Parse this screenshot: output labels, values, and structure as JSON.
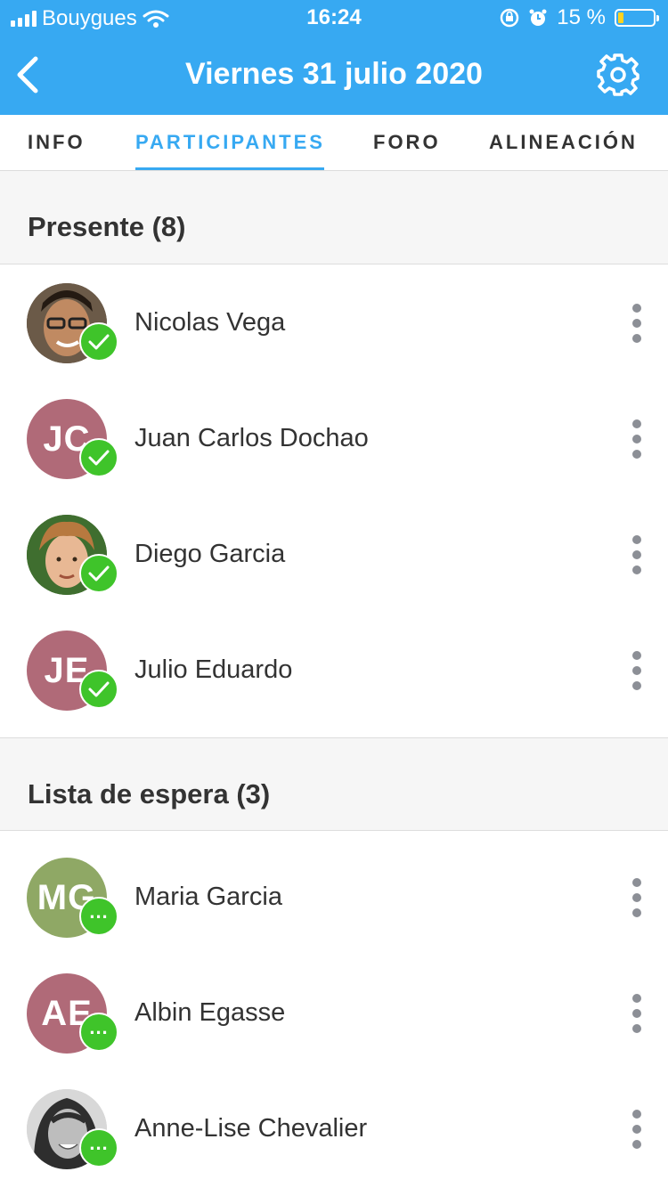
{
  "status_bar": {
    "carrier": "Bouygues",
    "time": "16:24",
    "battery": "15 %"
  },
  "header": {
    "title": "Viernes 31 julio 2020"
  },
  "tabs": [
    {
      "label": "INFO"
    },
    {
      "label": "PARTICIPANTES"
    },
    {
      "label": "FORO"
    },
    {
      "label": "ALINEACIÓN"
    }
  ],
  "present": {
    "title": "Presente (8)",
    "items": [
      {
        "name": "Nicolas Vega",
        "initials": "",
        "status": "confirmed"
      },
      {
        "name": "Juan Carlos Dochao",
        "initials": "JC",
        "status": "confirmed"
      },
      {
        "name": "Diego Garcia",
        "initials": "",
        "status": "confirmed"
      },
      {
        "name": "Julio Eduardo",
        "initials": "JE",
        "status": "confirmed"
      }
    ]
  },
  "waiting": {
    "title": "Lista de espera (3)",
    "items": [
      {
        "name": "Maria Garcia",
        "initials": "MG",
        "status": "pending"
      },
      {
        "name": "Albin Egasse",
        "initials": "AE",
        "status": "pending"
      },
      {
        "name": "Anne-Lise Chevalier",
        "initials": "",
        "status": "pending"
      }
    ]
  },
  "colors": {
    "accent": "#37a9f2",
    "badge": "#3fc42a",
    "avatar_rose": "#b06a78",
    "avatar_olive": "#8fa865"
  }
}
